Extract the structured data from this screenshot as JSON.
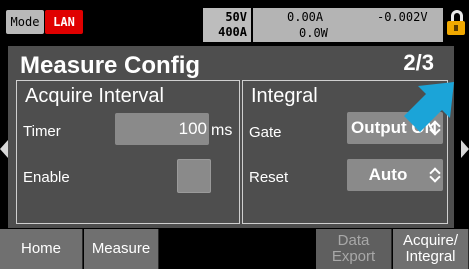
{
  "status_bar": {
    "mode_label": "Mode",
    "lan_label": "LAN",
    "voltage_range": "50V",
    "current_range": "400A",
    "current_readout": "0.00A",
    "voltage_readout": "-0.002V",
    "power_readout": "0.0W",
    "lock_icon": "lock-icon",
    "lock_color": "#f0a800",
    "lan_color": "#e00000"
  },
  "page": {
    "title": "Measure Config",
    "indicator": "2/3"
  },
  "acquire_interval": {
    "title": "Acquire Interval",
    "timer_label": "Timer",
    "timer_value": "100",
    "timer_unit": "ms",
    "enable_label": "Enable"
  },
  "integral": {
    "title": "Integral",
    "gate_label": "Gate",
    "gate_value": "Output ON",
    "reset_label": "Reset",
    "reset_value": "Auto"
  },
  "pointer": {
    "icon": "pointer-arrow-icon",
    "color": "#1ba4d8"
  },
  "softkeys": {
    "home": "Home",
    "measure": "Measure",
    "data_line1": "Data",
    "data_line2": "Export",
    "acquire_line1": "Acquire/",
    "acquire_line2": "Integral"
  }
}
